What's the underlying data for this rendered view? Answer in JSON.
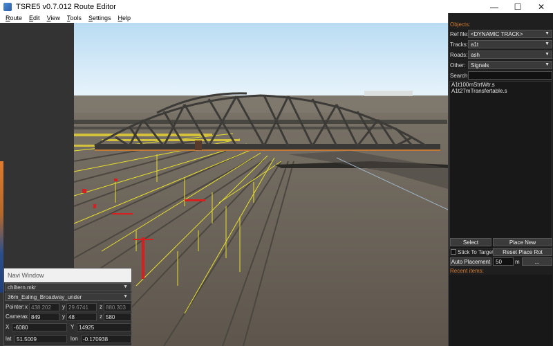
{
  "window": {
    "title": "TSRE5 v0.7.012 Route Editor",
    "minimize": "—",
    "maximize": "☐",
    "close": "✕"
  },
  "menu": [
    {
      "accel": "R",
      "rest": "oute"
    },
    {
      "accel": "E",
      "rest": "dit"
    },
    {
      "accel": "V",
      "rest": "iew"
    },
    {
      "accel": "T",
      "rest": "ools"
    },
    {
      "accel": "S",
      "rest": "ettings"
    },
    {
      "accel": "H",
      "rest": "elp"
    }
  ],
  "navi": {
    "title": "Navi Window",
    "marker_file": "chiltern.mkr",
    "marker": "36m_Ealing_Broadway_under",
    "pointer": {
      "label": "Pointer:",
      "x": "438.202",
      "y": "29.6741",
      "z": "880.303"
    },
    "camera": {
      "label": "Camera:",
      "x": "849",
      "y": "48",
      "z": "580"
    },
    "tile": {
      "x": "-6080",
      "y": "14925"
    },
    "geo": {
      "lat": "51.5009",
      "lon": "-0.170938"
    },
    "labels": {
      "x": "x",
      "y": "y",
      "z": "z",
      "X": "X",
      "Y": "Y",
      "lat": "lat",
      "lon": "lon"
    }
  },
  "objects": {
    "heading": "Objects:",
    "ref_file_label": "Ref file:",
    "ref_file": "<DYNAMIC TRACK>",
    "tracks_label": "Tracks:",
    "tracks": "a1t",
    "roads_label": "Roads:",
    "roads": "ash",
    "other_label": "Other:",
    "other": "Signals",
    "search_label": "Search:",
    "search_value": "",
    "items": [
      "A1t100mStrtWtr.s",
      "A1t27mTransfertable.s"
    ],
    "select_btn": "Select",
    "place_new_btn": "Place New",
    "stick_label": "Stick To Target",
    "reset_rot_btn": "Reset Place Rot",
    "auto_place_btn": "Auto Placement",
    "auto_dist": "50",
    "auto_unit": "m",
    "more_btn": "...",
    "recent_heading": "Recent items:"
  },
  "colors": {
    "accent": "#d07a30",
    "sky": "#cfe6f5",
    "ground": "#6b645a",
    "bridge": "#3d3b37",
    "wire": "#e8e02a",
    "signal": "#d81e1e"
  }
}
